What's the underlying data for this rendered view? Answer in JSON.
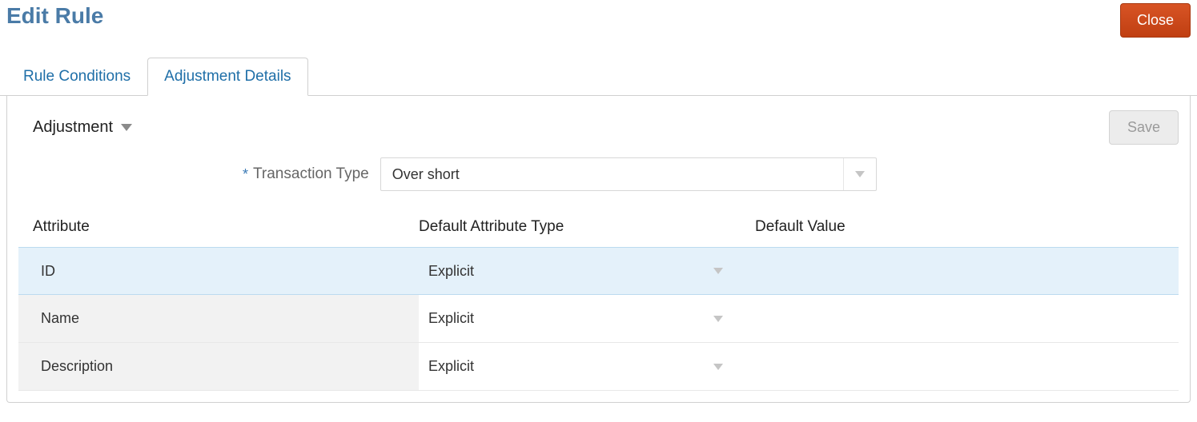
{
  "page": {
    "title": "Edit Rule",
    "close_label": "Close"
  },
  "tabs": {
    "rule_conditions": "Rule Conditions",
    "adjustment_details": "Adjustment Details"
  },
  "section": {
    "title": "Adjustment",
    "save_label": "Save"
  },
  "form": {
    "required_marker": "*",
    "transaction_type_label": "Transaction Type",
    "transaction_type_value": "Over short"
  },
  "table": {
    "headers": {
      "attribute": "Attribute",
      "default_attribute_type": "Default Attribute Type",
      "default_value": "Default Value"
    },
    "rows": [
      {
        "attribute": "ID",
        "type": "Explicit",
        "value": "",
        "selected": true
      },
      {
        "attribute": "Name",
        "type": "Explicit",
        "value": "",
        "selected": false
      },
      {
        "attribute": "Description",
        "type": "Explicit",
        "value": "",
        "selected": false
      }
    ]
  }
}
